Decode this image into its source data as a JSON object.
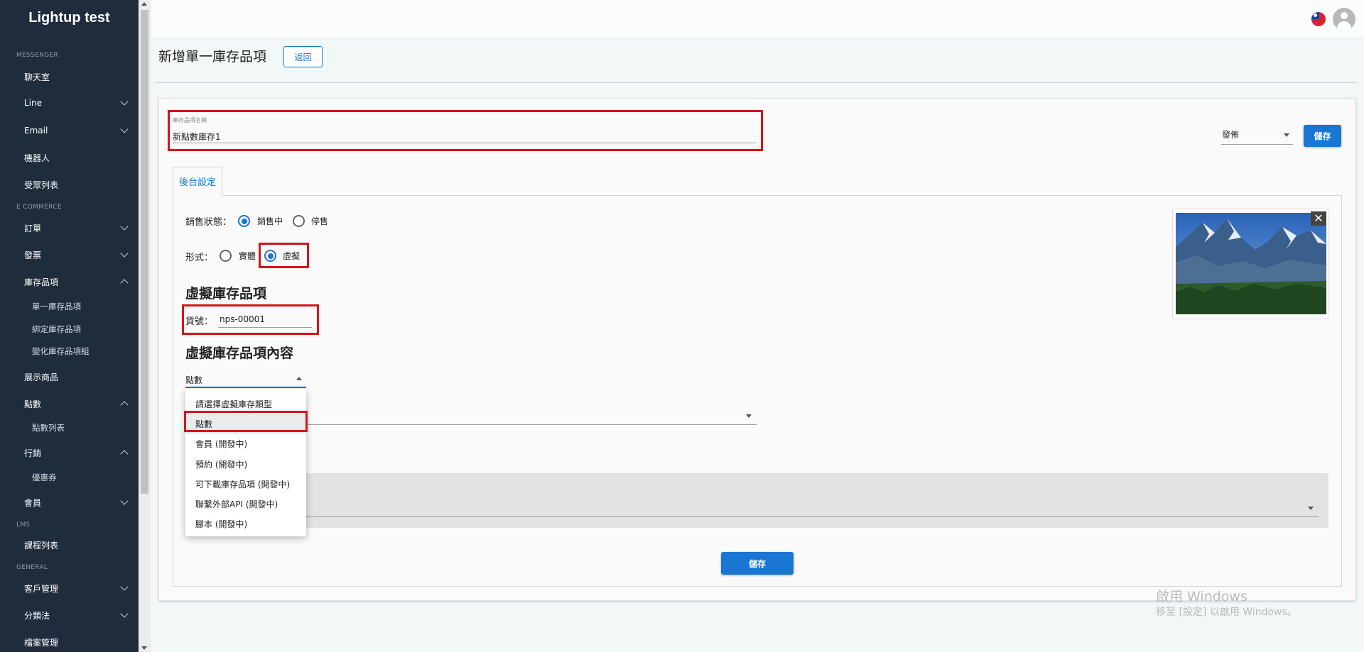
{
  "app": {
    "title": "Lightup test"
  },
  "sidebar": {
    "sections": {
      "messenger": "MESSENGER",
      "ecommerce": "E COMMERCE",
      "lms": "LMS",
      "general": "GENERAL"
    },
    "items": {
      "chat": "聊天室",
      "line": "Line",
      "email": "Email",
      "robot": "機器人",
      "audience": "受眾列表",
      "orders": "訂單",
      "invoice": "發票",
      "inventory": "庫存品項",
      "single_inventory": "單一庫存品項",
      "bundle_inventory": "綁定庫存品項",
      "variant_group": "變化庫存品項組",
      "showcase": "展示商品",
      "points": "點數",
      "points_list": "點數列表",
      "marketing": "行銷",
      "coupon": "優惠券",
      "member": "會員",
      "courses": "課程列表",
      "customers": "客戶管理",
      "taxonomy": "分類法",
      "files": "檔案管理"
    }
  },
  "header": {
    "page_title": "新增單一庫存品項",
    "back_label": "返回"
  },
  "form": {
    "name_label": "庫存品項名稱",
    "name_value": "新點數庫存1",
    "publish_value": "發佈",
    "save_label": "儲存",
    "tab_label": "後台設定",
    "sale_status_label": "銷售狀態：",
    "sale_on": "銷售中",
    "sale_off": "停售",
    "format_label": "形式：",
    "format_physical": "實體",
    "format_virtual": "虛擬",
    "virtual_heading": "虛擬庫存品項",
    "sku_label": "貨號：",
    "sku_value": "nps-00001",
    "content_heading": "虛擬庫存品項內容",
    "content_type_value": "點數",
    "bottom_save_label": "儲存"
  },
  "dropdown": {
    "options": [
      "請選擇虛擬庫存類型",
      "點數",
      "會員 (開發中)",
      "預約 (開發中)",
      "可下載庫存品項 (開發中)",
      "聯繫外部API (開發中)",
      "腳本 (開發中)"
    ],
    "selected": "點數"
  },
  "watermark": {
    "line1": "啟用 Windows",
    "line2": "移至 [設定] 以啟用 Windows。"
  },
  "colors": {
    "sidebar": "#1f2c3c",
    "primary": "#1976d2",
    "highlight": "#d3151b"
  },
  "icons": {
    "chevron": "chevron-down-icon",
    "close": "close-icon",
    "avatar": "avatar-icon",
    "flag": "taiwan-flag-icon"
  }
}
